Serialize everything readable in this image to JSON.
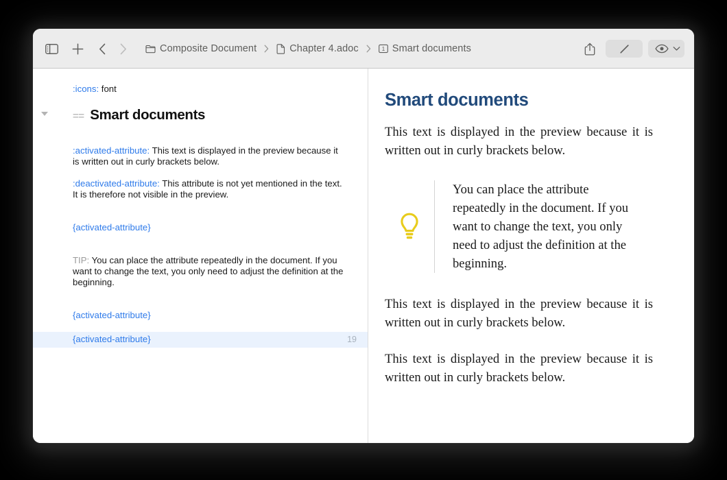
{
  "window": {
    "title": "Smart documents"
  },
  "toolbar": {
    "sidebar_toggle_name": "sidebar-toggle",
    "add_label": "+",
    "back_tooltip": "Back",
    "forward_tooltip": "Forward",
    "breadcrumb": [
      {
        "icon": "folder-icon",
        "label": "Composite Document"
      },
      {
        "icon": "document-icon",
        "label": "Chapter 4.adoc"
      },
      {
        "icon": "section-number-icon",
        "label": "Smart documents",
        "badge": "1"
      }
    ],
    "separator": "›",
    "share_icon": "share-icon",
    "edit_icon": "pencil-icon",
    "view_icon": "eye-icon",
    "view_chevron": "chevron-down-icon"
  },
  "editor": {
    "selected_line_number": "19",
    "lines": [
      {
        "id": "attr-icons",
        "type": "attribute",
        "attribute": ":icons:",
        "value": " font"
      },
      {
        "id": "section-heading",
        "type": "heading",
        "marker": "==",
        "text": "Smart documents",
        "folded": false
      },
      {
        "id": "attr-activated",
        "type": "attribute-paragraph",
        "attribute": ":activated-attribute:",
        "value": " This text is displayed in the preview because it is written out in curly brackets below."
      },
      {
        "id": "attr-deactivated",
        "type": "attribute-paragraph",
        "attribute": ":deactivated-attribute:",
        "value": " This attribute is not yet mentioned in the text. It is therefore not visible in the preview."
      },
      {
        "id": "ref-1",
        "type": "reference",
        "text": "{activated-attribute}"
      },
      {
        "id": "tip-block",
        "type": "tip",
        "label": "TIP:",
        "text": " You can place the attribute repeatedly in the document. If you want to change the text, you only need to adjust the definition at the beginning."
      },
      {
        "id": "ref-2",
        "type": "reference",
        "text": "{activated-attribute}"
      },
      {
        "id": "ref-3",
        "type": "reference",
        "text": "{activated-attribute}",
        "highlighted": true
      }
    ]
  },
  "preview": {
    "title": "Smart documents",
    "paragraph_1": "This text is displayed in the preview because it is written out in curly brackets below.",
    "admonition": {
      "kind": "tip",
      "icon": "lightbulb-icon",
      "icon_color": "#e8cc1c",
      "text": "You can place the attribute repeatedly in the document. If you want to change the text, you only need to adjust the definition at the beginning."
    },
    "paragraph_2": "This text is displayed in the preview because it is written out in curly brackets below.",
    "paragraph_3": "This text is displayed in the preview because it is written out in curly brackets below."
  },
  "colors": {
    "toolbar_background": "#ececec",
    "attribute_blue": "#2f7bea",
    "preview_heading": "#214a7b",
    "line_highlight": "#eaf2fd",
    "tip_yellow": "#e8cc1c"
  }
}
